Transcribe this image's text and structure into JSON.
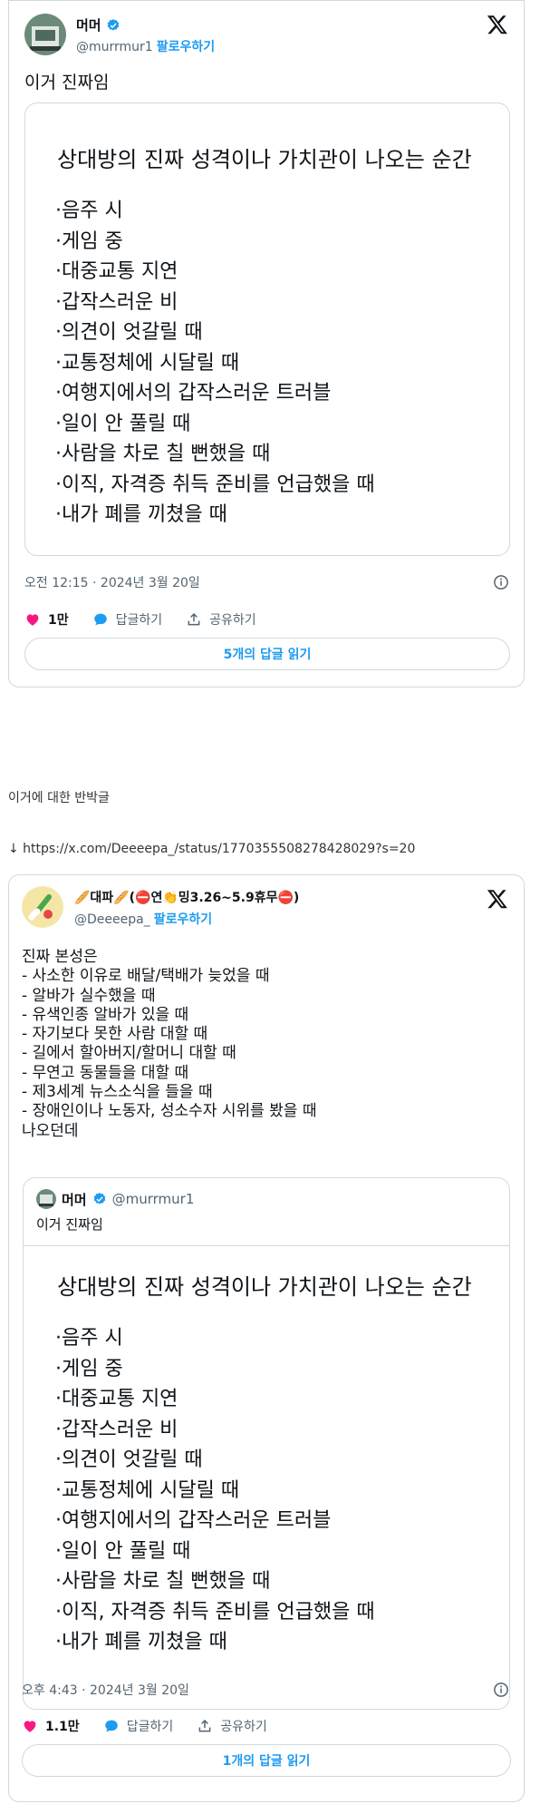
{
  "tweet1": {
    "display_name": "머머",
    "handle": "@murrmur1",
    "follow_label": "팔로우하기",
    "text": "이거 진짜임",
    "image": {
      "title": "상대방의 진짜 성격이나 가치관이 나오는 순간",
      "items": [
        "·음주 시",
        "·게임 중",
        "·대중교통 지연",
        "·갑작스러운 비",
        "·의견이 엇갈릴 때",
        "·교통정체에 시달릴 때",
        "·여행지에서의 갑작스러운 트러블",
        "·일이 안 풀릴 때",
        "·사람을 차로 칠 뻔했을 때",
        "·이직, 자격증 취득 준비를 언급했을 때",
        "·내가 폐를 끼쳤을 때"
      ]
    },
    "timestamp": "오전 12:15 · 2024년 3월 20일",
    "likes": "1만",
    "reply_label": "답글하기",
    "share_label": "공유하기",
    "read_replies": "5개의 답글 읽기"
  },
  "caption": "이거에 대한 반박글",
  "link": "↓ https://x.com/Deeeepa_/status/1770355508278428029?s=20",
  "tweet2": {
    "display_name": "🥖대파🥖(⛔연👏밍3.26~5.9휴무⛔)",
    "handle": "@Deeeepa_",
    "follow_label": "팔로우하기",
    "text_lines": [
      "진짜 본성은",
      "- 사소한 이유로 배달/택배가 늦었을 때",
      "- 알바가 실수했을 때",
      "- 유색인종 알바가 있을 때",
      "- 자기보다 못한 사람 대할 때",
      "- 길에서 할아버지/할머니 대할 때",
      "- 무연고 동물들을 대할 때",
      "- 제3세계 뉴스소식을 들을 때",
      "- 장애인이나 노동자, 성소수자 시위를 봤을 때",
      "나오던데"
    ],
    "quote": {
      "display_name": "머머",
      "handle": "@murrmur1",
      "text": "이거 진짜임",
      "image": {
        "title": "상대방의 진짜 성격이나 가치관이 나오는 순간",
        "items": [
          "·음주 시",
          "·게임 중",
          "·대중교통 지연",
          "·갑작스러운 비",
          "·의견이 엇갈릴 때",
          "·교통정체에 시달릴 때",
          "·여행지에서의 갑작스러운 트러블",
          "·일이 안 풀릴 때",
          "·사람을 차로 칠 뻔했을 때",
          "·이직, 자격증 취득 준비를 언급했을 때",
          "·내가 폐를 끼쳤을 때"
        ]
      }
    },
    "timestamp": "오후 4:43 · 2024년 3월 20일",
    "likes": "1.1만",
    "reply_label": "답글하기",
    "share_label": "공유하기",
    "read_replies": "1개의 답글 읽기"
  },
  "colors": {
    "accent": "#1d9bf0",
    "like": "#f91880",
    "text": "#0f1419",
    "muted": "#536471",
    "border": "#cfd9de"
  },
  "icons": [
    "verified-badge-icon",
    "x-logo-icon",
    "heart-icon",
    "reply-bubble-icon",
    "share-icon",
    "info-icon"
  ]
}
